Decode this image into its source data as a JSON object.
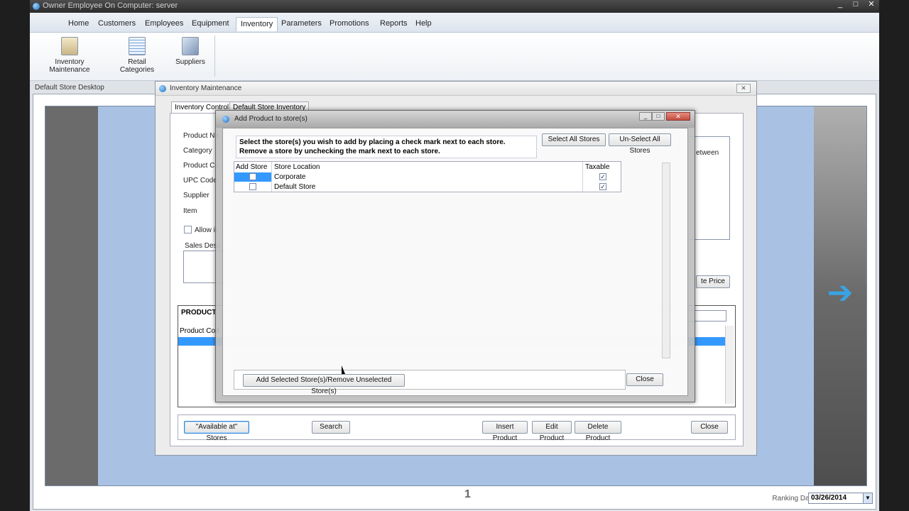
{
  "window": {
    "title": "Owner Employee On Computer: server",
    "min": "_",
    "max": "□",
    "close": "✕"
  },
  "menu": {
    "items": [
      "Home",
      "Customers",
      "Employees",
      "Equipment",
      "Inventory",
      "Parameters",
      "Promotions",
      "Reports",
      "Help"
    ],
    "active": "Inventory"
  },
  "ribbon": {
    "buttons": [
      {
        "label": "Inventory Maintenance",
        "icon": "inventory-maintenance-icon"
      },
      {
        "label": "Retail Categories",
        "icon": "retail-categories-icon"
      },
      {
        "label": "Suppliers",
        "icon": "suppliers-icon"
      }
    ]
  },
  "desktop": {
    "label": "Default Store Desktop",
    "page_number": "1",
    "ranking_label": "Ranking Date",
    "ranking_date": "03/26/2014",
    "arrow_glyph": "➔",
    "dropdown_glyph": "▼"
  },
  "inventory": {
    "title": "Inventory Maintenance",
    "close": "✕",
    "tabs": [
      "Inventory Control",
      "Default Store Inventory"
    ],
    "fields": [
      "Product Na",
      "Category",
      "Product Co",
      "UPC Code",
      "Supplier",
      "Item"
    ],
    "allow_label": "Allow it",
    "sales_desc_label": "Sales Desc",
    "between_text": "etween",
    "price_btn": "te Price",
    "grid": {
      "header": "PRODUCT",
      "column": "Product Cod"
    },
    "buttons": {
      "available": "\"Available at\" Stores",
      "search": "Search",
      "insert": "Insert Product",
      "edit": "Edit Product",
      "delete": "Delete Product",
      "close": "Close"
    }
  },
  "modal": {
    "title": "Add Product to store(s)",
    "min": "_",
    "max": "□",
    "close": "✕",
    "instructions_line1": "Select the store(s) you wish to add by placing a check mark next to each store.",
    "instructions_line2": "Remove a store by unchecking the mark next to each store.",
    "select_all": "Select All Stores",
    "unselect_all": "Un-Select All Stores",
    "columns": {
      "add_store": "Add Store",
      "location": "Store Location",
      "taxable": "Taxable"
    },
    "rows": [
      {
        "location": "Corporate",
        "added": false,
        "taxable": true,
        "selected": true
      },
      {
        "location": "Default Store",
        "added": false,
        "taxable": true,
        "selected": false
      }
    ],
    "check_glyph": "✓",
    "add_button": "Add Selected Store(s)/Remove Unselected Store(s)",
    "close_button": "Close"
  }
}
